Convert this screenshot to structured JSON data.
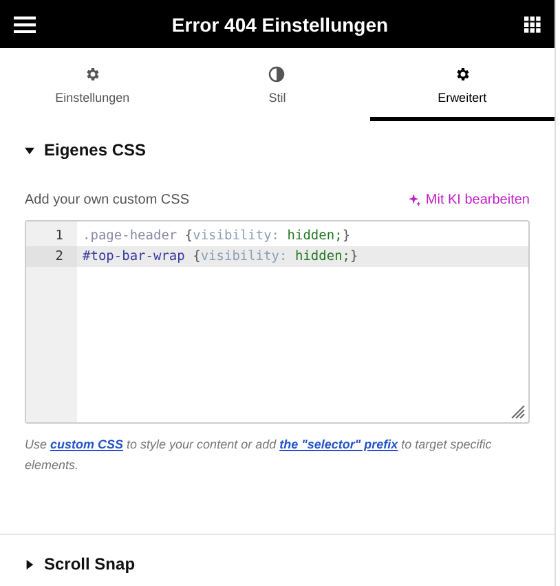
{
  "header": {
    "title": "Error 404 Einstellungen"
  },
  "tabs": [
    {
      "label": "Einstellungen",
      "kind": "gear",
      "selected": false
    },
    {
      "label": "Stil",
      "kind": "contrast",
      "selected": false
    },
    {
      "label": "Erweitert",
      "kind": "gear",
      "selected": true
    }
  ],
  "sections": [
    {
      "title": "Eigenes CSS",
      "expanded": true,
      "field_label": "Add your own custom CSS",
      "ai_button": "Mit KI bearbeiten",
      "code_lines": [
        {
          "number": "1",
          "active": false,
          "tokens": [
            {
              "kind": "selector",
              "text": ".page-header"
            },
            {
              "kind": "brace",
              "text": "{"
            },
            {
              "kind": "property",
              "text": "visibility:"
            },
            {
              "kind": "value",
              "text": "hidden;"
            },
            {
              "kind": "brace",
              "text": "}"
            }
          ]
        },
        {
          "number": "2",
          "active": true,
          "tokens": [
            {
              "kind": "id",
              "text": "#top-bar-wrap"
            },
            {
              "kind": "brace",
              "text": "{"
            },
            {
              "kind": "property",
              "text": "visibility:"
            },
            {
              "kind": "value",
              "text": "hidden;"
            },
            {
              "kind": "brace",
              "text": "}"
            }
          ]
        }
      ],
      "help": [
        {
          "text": "Use ",
          "link": false
        },
        {
          "text": "custom CSS",
          "link": true
        },
        {
          "text": " to style your content or add ",
          "link": false
        },
        {
          "text": "the \"selector\" prefix",
          "link": true
        },
        {
          "text": " to target specific elements.",
          "link": false
        }
      ]
    },
    {
      "title": "Scroll Snap",
      "expanded": false
    }
  ]
}
